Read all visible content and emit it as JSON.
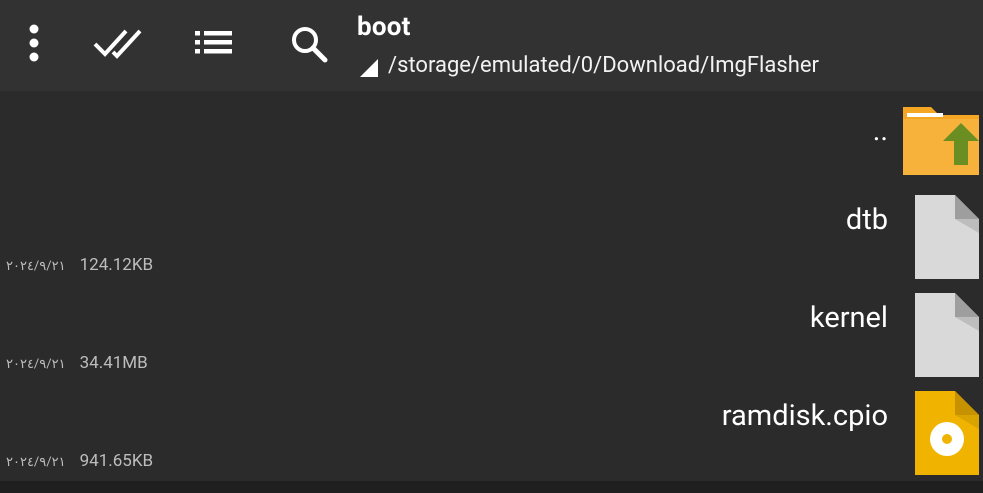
{
  "toolbar": {
    "title": "boot",
    "path": "/storage/emulated/0/Download/ImgFlasher",
    "buttons": [
      {
        "name": "more-options",
        "icon": "dots-vertical-icon"
      },
      {
        "name": "select-all",
        "icon": "double-check-icon"
      },
      {
        "name": "view-list",
        "icon": "list-icon"
      },
      {
        "name": "search",
        "icon": "search-icon"
      }
    ]
  },
  "files": [
    {
      "name": "..",
      "type": "parent-folder",
      "icon": "folder-up-icon"
    },
    {
      "name": "dtb",
      "size": "124.12KB",
      "date": "٢٠٢٤/٩/٢١",
      "icon": "file-icon"
    },
    {
      "name": "kernel",
      "size": "34.41MB",
      "date": "٢٠٢٤/٩/٢١",
      "icon": "file-icon"
    },
    {
      "name": "ramdisk.cpio",
      "size": "941.65KB",
      "date": "٢٠٢٤/٩/٢١",
      "icon": "disc-file-icon"
    }
  ],
  "colors": {
    "background": "#2b2b2b",
    "toolbar": "#323232",
    "folder": "#f5a623",
    "folder_arrow": "#6b8e23",
    "file": "#d9d9d9",
    "disc_file": "#f0b400"
  }
}
